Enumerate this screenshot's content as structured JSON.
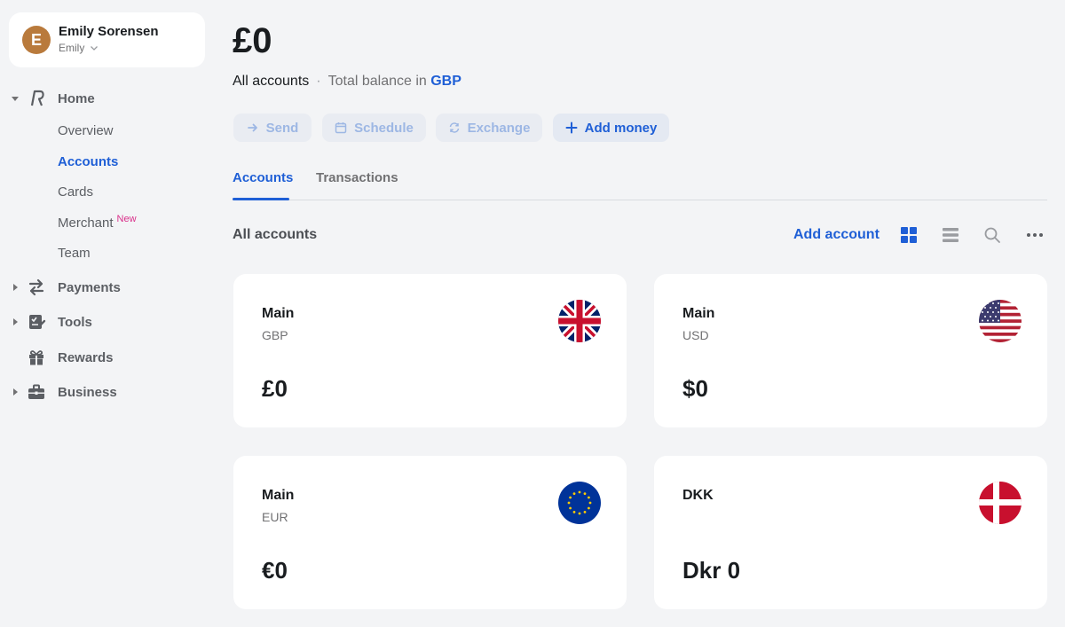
{
  "user": {
    "initial": "E",
    "name": "Emily Sorensen",
    "handle": "Emily"
  },
  "sidebar": {
    "home": "Home",
    "home_items": [
      "Overview",
      "Accounts",
      "Cards",
      "Merchant",
      "Team"
    ],
    "merchant_badge": "New",
    "payments": "Payments",
    "tools": "Tools",
    "rewards": "Rewards",
    "business": "Business"
  },
  "header": {
    "balance": "£0",
    "scope": "All accounts",
    "separator": "·",
    "balance_note": "Total balance in",
    "currency": "GBP"
  },
  "actions": {
    "send": "Send",
    "schedule": "Schedule",
    "exchange": "Exchange",
    "add_money": "Add money"
  },
  "tabs": [
    "Accounts",
    "Transactions"
  ],
  "accounts_section": {
    "title": "All accounts",
    "add_account": "Add account"
  },
  "accounts": [
    {
      "name": "Main",
      "currency": "GBP",
      "balance": "£0",
      "flag": "gb-flag-icon"
    },
    {
      "name": "Main",
      "currency": "USD",
      "balance": "$0",
      "flag": "us-flag-icon"
    },
    {
      "name": "Main",
      "currency": "EUR",
      "balance": "€0",
      "flag": "eu-flag-icon"
    },
    {
      "name": "DKK",
      "currency": "",
      "balance": "Dkr 0",
      "flag": "dk-flag-icon"
    }
  ],
  "colors": {
    "accent": "#1f5fd6",
    "badge": "#d92f8a",
    "avatar": "#b97a3c"
  }
}
